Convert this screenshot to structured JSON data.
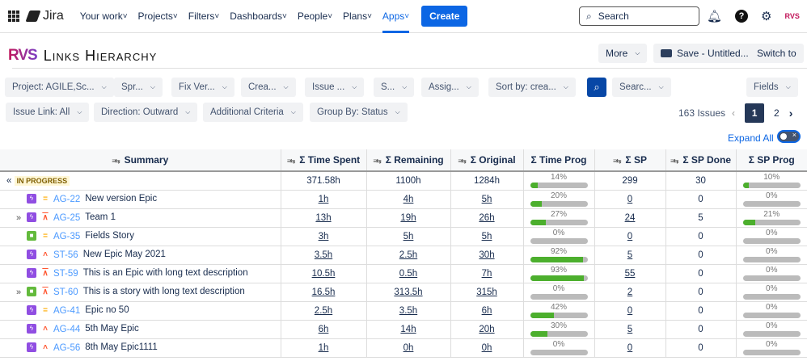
{
  "topnav": {
    "app": "Jira",
    "items": [
      "Your work",
      "Projects",
      "Filters",
      "Dashboards",
      "People",
      "Plans",
      "Apps"
    ],
    "active": "Apps",
    "create": "Create",
    "search_placeholder": "Search",
    "avatar": "RVS"
  },
  "page": {
    "logo": "RVS",
    "title": "Links Hierarchy",
    "more": "More",
    "save": "Save - Untitled...",
    "switch": "Switch to"
  },
  "filters_row1": [
    "Project: AGILE,Sc...",
    "Spr...",
    "Fix Ver...",
    "Crea...",
    "Issue ...",
    "S...",
    "Assig...",
    "Sort by: crea...",
    "Searc..."
  ],
  "fields": "Fields",
  "filters_row2": [
    "Issue Link: All",
    "Direction: Outward",
    "Additional Criteria",
    "Group By: Status"
  ],
  "pagination": {
    "count": "163 Issues",
    "pages": [
      "1",
      "2"
    ],
    "current": "1"
  },
  "expand_all": "Expand All",
  "expand_all_on": false,
  "columns": [
    "Summary",
    "Σ Time Spent",
    "Σ Remaining",
    "Σ Original",
    "Σ Time Prog",
    "Σ SP",
    "Σ SP Done",
    "Σ SP Prog"
  ],
  "group": {
    "label": "IN PROGRESS",
    "time_spent": "371.58h",
    "remaining": "1100h",
    "original": "1284h",
    "time_prog": 14,
    "sp": "299",
    "sp_done": "30",
    "sp_prog": 10
  },
  "colors": {
    "accent": "#0c66e4",
    "epic": "#904ee2",
    "story": "#63ba3c",
    "progress": "#4caf2d",
    "medium": "#ffab00",
    "high": "#ff5630"
  },
  "rows": [
    {
      "key": "AG-22",
      "summary": "New version Epic",
      "type": "epic",
      "priority": "medium",
      "expandable": false,
      "time_spent": "1h",
      "remaining": "4h",
      "original": "5h",
      "time_prog": 20,
      "sp": "0",
      "sp_done": "0",
      "sp_prog": 0
    },
    {
      "key": "AG-25",
      "summary": "Team 1",
      "type": "epic",
      "priority": "highest",
      "expandable": true,
      "time_spent": "13h",
      "remaining": "19h",
      "original": "26h",
      "time_prog": 27,
      "sp": "24",
      "sp_done": "5",
      "sp_prog": 21
    },
    {
      "key": "AG-35",
      "summary": "Fields Story",
      "type": "story",
      "priority": "medium",
      "expandable": false,
      "time_spent": "3h",
      "remaining": "5h",
      "original": "5h",
      "time_prog": 0,
      "sp": "0",
      "sp_done": "0",
      "sp_prog": 0
    },
    {
      "key": "ST-56",
      "summary": "New Epic May 2021",
      "type": "epic",
      "priority": "high",
      "expandable": false,
      "time_spent": "3.5h",
      "remaining": "2.5h",
      "original": "30h",
      "time_prog": 92,
      "sp": "5",
      "sp_done": "0",
      "sp_prog": 0
    },
    {
      "key": "ST-59",
      "summary": "This is an Epic with long text description",
      "type": "epic",
      "priority": "highest",
      "expandable": false,
      "time_spent": "10.5h",
      "remaining": "0.5h",
      "original": "7h",
      "time_prog": 93,
      "sp": "55",
      "sp_done": "0",
      "sp_prog": 0
    },
    {
      "key": "ST-60",
      "summary": "This is a story with long text description",
      "type": "story",
      "priority": "highest",
      "expandable": true,
      "time_spent": "16.5h",
      "remaining": "313.5h",
      "original": "315h",
      "time_prog": 0,
      "sp": "2",
      "sp_done": "0",
      "sp_prog": 0
    },
    {
      "key": "AG-41",
      "summary": "Epic no 50",
      "type": "epic",
      "priority": "medium",
      "expandable": false,
      "time_spent": "2.5h",
      "remaining": "3.5h",
      "original": "6h",
      "time_prog": 42,
      "sp": "0",
      "sp_done": "0",
      "sp_prog": 0
    },
    {
      "key": "AG-44",
      "summary": "5th May Epic",
      "type": "epic",
      "priority": "high",
      "expandable": false,
      "time_spent": "6h",
      "remaining": "14h",
      "original": "20h",
      "time_prog": 30,
      "sp": "5",
      "sp_done": "0",
      "sp_prog": 0
    },
    {
      "key": "AG-56",
      "summary": "8th May Epic1111",
      "type": "epic",
      "priority": "high",
      "expandable": false,
      "time_spent": "1h",
      "remaining": "0h",
      "original": "0h",
      "time_prog": 0,
      "sp": "0",
      "sp_done": "0",
      "sp_prog": 0
    }
  ]
}
